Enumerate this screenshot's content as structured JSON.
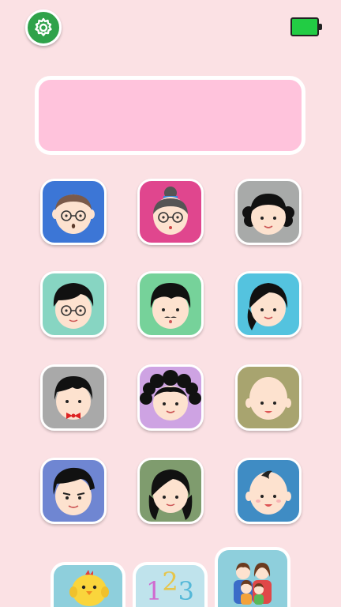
{
  "toolbar": {
    "settings_icon": "gear-icon",
    "battery_icon": "battery-icon",
    "battery_color": "#22cc44"
  },
  "display": {
    "text": ""
  },
  "contacts": [
    {
      "name": "grandpa",
      "bg": "#3c76d6"
    },
    {
      "name": "grandma",
      "bg": "#e0468e"
    },
    {
      "name": "aunt",
      "bg": "#a8aaa9"
    },
    {
      "name": "dad",
      "bg": "#87d5c2"
    },
    {
      "name": "uncle",
      "bg": "#76d29a"
    },
    {
      "name": "mom",
      "bg": "#54c3df"
    },
    {
      "name": "brother",
      "bg": "#a9a9a9"
    },
    {
      "name": "sister",
      "bg": "#cea3e3"
    },
    {
      "name": "baby",
      "bg": "#a8a46f"
    },
    {
      "name": "boy",
      "bg": "#6f86d2"
    },
    {
      "name": "girl",
      "bg": "#7f9c6e"
    },
    {
      "name": "infant",
      "bg": "#3f8cc4"
    }
  ],
  "bottom_nav": {
    "animals_icon": "chick-icon",
    "numbers_label": [
      "1",
      "2",
      "3"
    ],
    "numbers_colors": [
      "#55b8d8",
      "#55b8d8",
      "#55b8d8"
    ],
    "family_icon": "family-icon"
  }
}
